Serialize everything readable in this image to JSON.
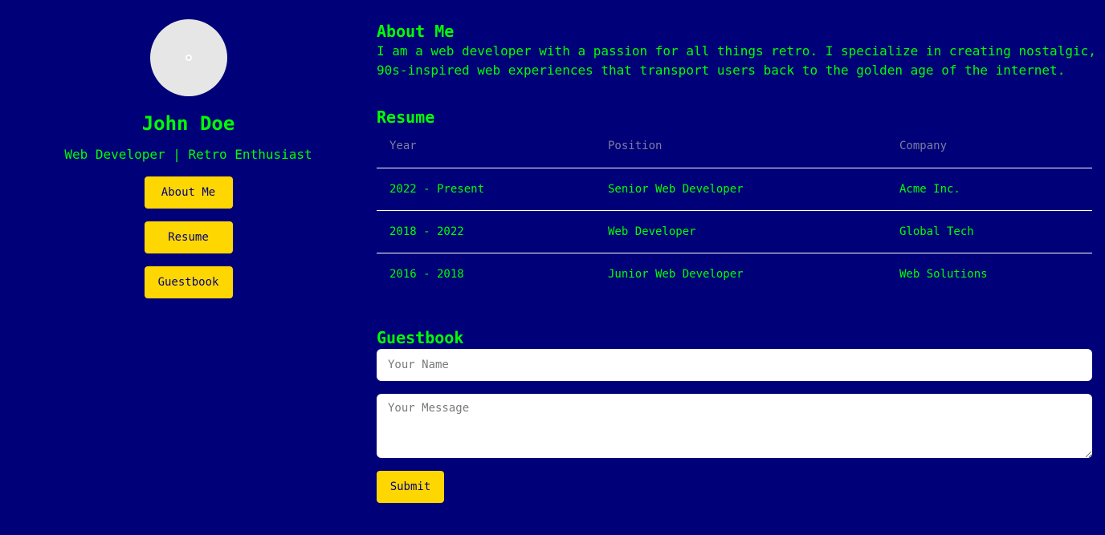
{
  "profile": {
    "name": "John Doe",
    "tagline": "Web Developer | Retro Enthusiast",
    "avatar_icon": "user-avatar-icon"
  },
  "nav": {
    "items": [
      {
        "label": "About Me"
      },
      {
        "label": "Resume"
      },
      {
        "label": "Guestbook"
      }
    ]
  },
  "about": {
    "title": "About Me",
    "text": "I am a web developer with a passion for all things retro. I specialize in creating nostalgic, 90s-inspired web experiences that transport users back to the golden age of the internet."
  },
  "resume": {
    "title": "Resume",
    "headers": [
      "Year",
      "Position",
      "Company"
    ],
    "rows": [
      [
        "2022 - Present",
        "Senior Web Developer",
        "Acme Inc."
      ],
      [
        "2018 - 2022",
        "Web Developer",
        "Global Tech"
      ],
      [
        "2016 - 2018",
        "Junior Web Developer",
        "Web Solutions"
      ]
    ]
  },
  "guestbook": {
    "title": "Guestbook",
    "name_placeholder": "Your Name",
    "message_placeholder": "Your Message",
    "submit_label": "Submit"
  },
  "colors": {
    "background": "#000078",
    "text_accent": "#00ff00",
    "button": "#ffd700"
  }
}
